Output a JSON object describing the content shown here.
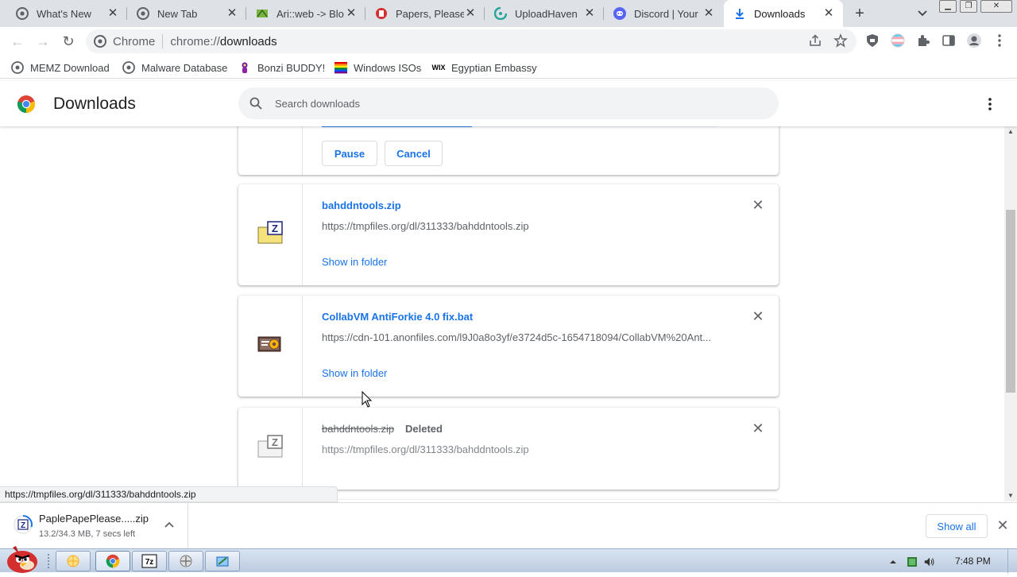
{
  "browser": {
    "tabs": [
      {
        "title": "What's New",
        "icon": "chrome-icon"
      },
      {
        "title": "New Tab",
        "icon": "chrome-icon"
      },
      {
        "title": "Ari::web -> Blo",
        "icon": "ariweb-icon"
      },
      {
        "title": "Papers, Please",
        "icon": "papers-please-icon"
      },
      {
        "title": "UploadHaven",
        "icon": "uploadhaven-icon"
      },
      {
        "title": "Discord | Your",
        "icon": "discord-icon"
      },
      {
        "title": "Downloads",
        "icon": "download-icon",
        "active": true
      }
    ],
    "omnibox": {
      "chip": "Chrome",
      "scheme": "chrome://",
      "host": "downloads"
    },
    "bookmarks": [
      {
        "label": "MEMZ Download",
        "icon": "globe-icon"
      },
      {
        "label": "Malware Database",
        "icon": "globe-icon"
      },
      {
        "label": "Bonzi BUDDY!",
        "icon": "bonzi-icon"
      },
      {
        "label": "Windows ISOs",
        "icon": "windows-flag-icon"
      },
      {
        "label": "Egyptian Embassy",
        "icon": "wix-icon"
      }
    ]
  },
  "downloads_page": {
    "title": "Downloads",
    "search_placeholder": "Search downloads",
    "in_progress": {
      "pause_label": "Pause",
      "cancel_label": "Cancel",
      "progress": 0.38
    },
    "items": [
      {
        "filename": "bahddntools.zip",
        "url": "https://tmpfiles.org/dl/311333/bahddntools.zip",
        "action": "Show in folder",
        "file_icon": "zip-file-icon"
      },
      {
        "filename": "CollabVM AntiForkie 4.0 fix.bat",
        "url": "https://cdn-101.anonfiles.com/l9J0a8o3yf/e3724d5c-1654718094/CollabVM%20Ant...",
        "action": "Show in folder",
        "file_icon": "batch-file-icon"
      },
      {
        "filename": "bahddntools.zip",
        "status": "Deleted",
        "url": "https://tmpfiles.org/dl/311333/bahddntools.zip",
        "file_icon": "zip-file-icon"
      }
    ]
  },
  "status_bar": {
    "url": "https://tmpfiles.org/dl/311333/bahddntools.zip"
  },
  "shelf": {
    "filename": "PaplePapePlease.....zip",
    "progress_text": "13.2/34.3 MB, 7 secs left",
    "show_all": "Show all"
  },
  "taskbar": {
    "time": "7:48 PM"
  },
  "colors": {
    "accent": "#1a73e8",
    "tabstrip": "#dee1e6",
    "omnibox": "#f1f3f4"
  }
}
